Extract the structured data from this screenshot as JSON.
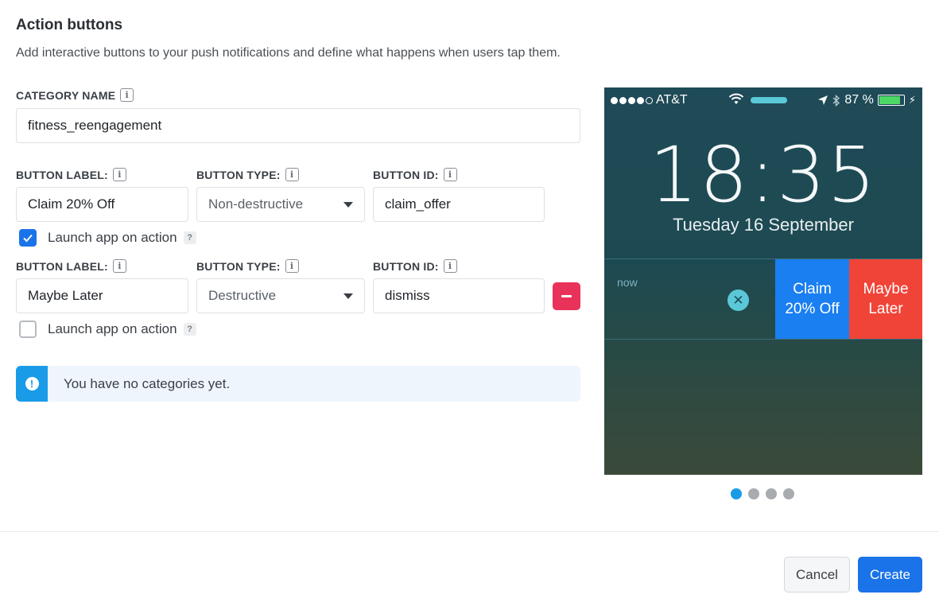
{
  "header": {
    "title": "Action buttons",
    "description": "Add interactive buttons to your push notifications and define what happens when users tap them."
  },
  "category": {
    "label": "CATEGORY NAME",
    "value": "fitness_reengagement"
  },
  "fields": {
    "button_label": "BUTTON LABEL:",
    "button_type": "BUTTON TYPE:",
    "button_id": "BUTTON ID:"
  },
  "buttons": [
    {
      "label_value": "Claim 20% Off",
      "type_value": "Non-destructive",
      "id_value": "claim_offer",
      "launch_label": "Launch app on action",
      "launch_checked": true
    },
    {
      "label_value": "Maybe Later",
      "type_value": "Destructive",
      "id_value": "dismiss",
      "launch_label": "Launch app on action",
      "launch_checked": false
    }
  ],
  "alert": {
    "message": "You have no categories yet."
  },
  "preview": {
    "carrier": "AT&T",
    "battery": "87 %",
    "time": "18:35",
    "date": "Tuesday 16 September",
    "notif_time": "now",
    "action1_line1": "Claim",
    "action1_line2": "20% Off",
    "action2_line1": "Maybe",
    "action2_line2": "Later",
    "colors": {
      "action1": "#1a7ff0",
      "action2": "#f04438"
    }
  },
  "pager": {
    "pages": 4,
    "active": 1
  },
  "footer": {
    "cancel": "Cancel",
    "create": "Create"
  },
  "colors": {
    "primary": "#1a73e8",
    "danger": "#e8325a",
    "info": "#1a9be8"
  }
}
